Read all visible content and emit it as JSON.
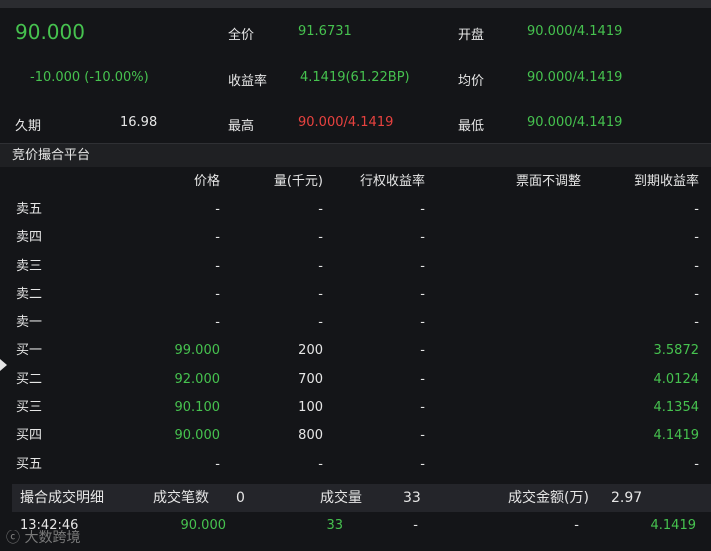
{
  "summary": {
    "last_price": "90.000",
    "change": "-10.000 (-10.00%)",
    "duration_label": "久期",
    "duration_value": "16.98",
    "full_price_label": "全价",
    "full_price_value": "91.6731",
    "yield_label": "收益率",
    "yield_value": "4.1419(61.22BP)",
    "high_label": "最高",
    "high_value": "90.000/4.1419",
    "open_label": "开盘",
    "open_value": "90.000/4.1419",
    "avg_label": "均价",
    "avg_value": "90.000/4.1419",
    "low_label": "最低",
    "low_value": "90.000/4.1419"
  },
  "platform": {
    "title": "竞价撮合平台",
    "headers": [
      "价格",
      "量(千元)",
      "行权收益率",
      "票面不调整",
      "到期收益率"
    ],
    "rows": [
      {
        "side": "卖五",
        "price": "-",
        "qty": "-",
        "exercise_yield": "-",
        "no_adjust": "",
        "maturity_yield": "-"
      },
      {
        "side": "卖四",
        "price": "-",
        "qty": "-",
        "exercise_yield": "-",
        "no_adjust": "",
        "maturity_yield": "-"
      },
      {
        "side": "卖三",
        "price": "-",
        "qty": "-",
        "exercise_yield": "-",
        "no_adjust": "",
        "maturity_yield": "-"
      },
      {
        "side": "卖二",
        "price": "-",
        "qty": "-",
        "exercise_yield": "-",
        "no_adjust": "",
        "maturity_yield": "-"
      },
      {
        "side": "卖一",
        "price": "-",
        "qty": "-",
        "exercise_yield": "-",
        "no_adjust": "",
        "maturity_yield": "-"
      },
      {
        "side": "买一",
        "price": "99.000",
        "qty": "200",
        "exercise_yield": "-",
        "no_adjust": "",
        "maturity_yield": "3.5872"
      },
      {
        "side": "买二",
        "price": "92.000",
        "qty": "700",
        "exercise_yield": "-",
        "no_adjust": "",
        "maturity_yield": "4.0124"
      },
      {
        "side": "买三",
        "price": "90.100",
        "qty": "100",
        "exercise_yield": "-",
        "no_adjust": "",
        "maturity_yield": "4.1354"
      },
      {
        "side": "买四",
        "price": "90.000",
        "qty": "800",
        "exercise_yield": "-",
        "no_adjust": "",
        "maturity_yield": "4.1419"
      },
      {
        "side": "买五",
        "price": "-",
        "qty": "-",
        "exercise_yield": "-",
        "no_adjust": "",
        "maturity_yield": "-"
      }
    ]
  },
  "trades": {
    "title": "撮合成交明细",
    "count_label": "成交笔数",
    "count_value": "0",
    "volume_label": "成交量",
    "volume_value": "33",
    "amount_label": "成交金额(万)",
    "amount_value": "2.97",
    "rows": [
      {
        "time": "13:42:46",
        "price": "90.000",
        "qty": "33",
        "exercise_yield": "-",
        "no_adjust": "-",
        "maturity_yield": "4.1419"
      }
    ]
  },
  "watermark": "大数跨境",
  "colors": {
    "up": "#46c24f",
    "down": "#e8423f",
    "background": "#141518"
  }
}
